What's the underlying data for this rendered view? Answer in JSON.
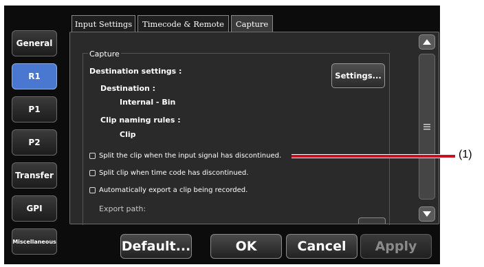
{
  "sidebar": {
    "items": [
      {
        "label": "General",
        "active": false
      },
      {
        "label": "R1",
        "active": true
      },
      {
        "label": "P1",
        "active": false
      },
      {
        "label": "P2",
        "active": false
      },
      {
        "label": "Transfer",
        "active": false
      },
      {
        "label": "GPI",
        "active": false
      },
      {
        "label": "Miscellaneous",
        "active": false
      }
    ]
  },
  "tabs": [
    {
      "label": "Input Settings",
      "active": false
    },
    {
      "label": "Timecode & Remote",
      "active": false
    },
    {
      "label": "Capture",
      "active": true
    }
  ],
  "capture": {
    "group_title": "Capture",
    "destination_settings_label": "Destination settings :",
    "destination_label": "Destination :",
    "destination_value": "Internal - Bin",
    "clip_naming_label": "Clip naming rules :",
    "clip_naming_value": "Clip",
    "settings_button": "Settings...",
    "options": [
      {
        "label": "Split the clip when the input signal has discontinued.",
        "checked": false
      },
      {
        "label": "Split clip when time code has discontinued.",
        "checked": false
      },
      {
        "label": "Automatically export a clip being recorded.",
        "checked": false
      }
    ],
    "export_path_label": "Export path:"
  },
  "footer": {
    "default_label": "Default...",
    "ok_label": "OK",
    "cancel_label": "Cancel",
    "apply_label": "Apply"
  },
  "annotation": {
    "callout": "(1)"
  },
  "colors": {
    "accent": "#4a78d0",
    "callout": "#c8101e",
    "background": "#0c0c0c"
  }
}
